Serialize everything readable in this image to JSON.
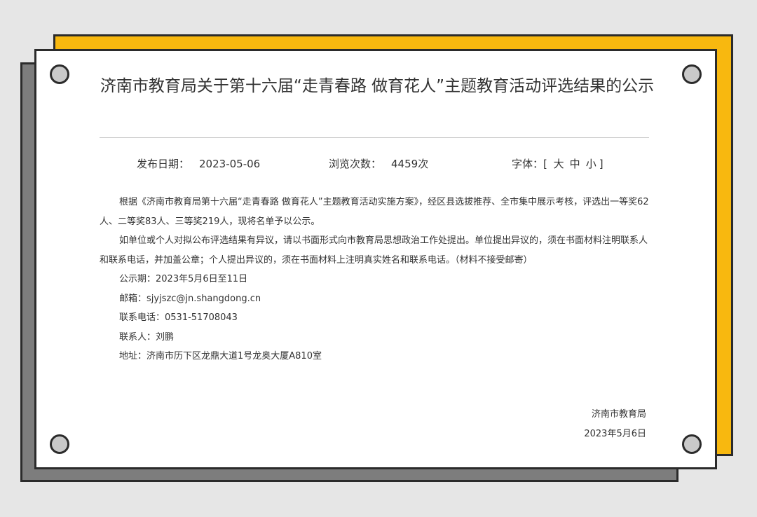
{
  "notice": {
    "title": "济南市教育局关于第十六届“走青春路 做育花人”主题教育活动评选结果的公示",
    "meta": {
      "date_label": "发布日期：",
      "date_value": "2023-05-06",
      "views_label": "浏览次数：",
      "views_value": "4459次",
      "font_label": "字体：",
      "font_open": "[",
      "font_large": "大",
      "font_medium": "中",
      "font_small": "小",
      "font_close": "]"
    },
    "paragraphs": [
      "根据《济南市教育局第十六届“走青春路 做育花人”主题教育活动实施方案》，经区县选拔推荐、全市集中展示考核，评选出一等奖62人、二等奖83人、三等奖219人，现将名单予以公示。",
      "如单位或个人对拟公布评选结果有异议，请以书面形式向市教育局思想政治工作处提出。单位提出异议的，须在书面材料注明联系人和联系电话，并加盖公章；个人提出异议的，须在书面材料上注明真实姓名和联系电话。（材料不接受邮寄）"
    ],
    "lines": [
      "公示期：2023年5月6日至11日",
      "邮箱：sjyjszc@jn.shangdong.cn",
      "联系电话：0531-51708043",
      "联系人：刘鹏",
      "地址：济南市历下区龙鼎大道1号龙奥大厦A810室"
    ],
    "signature_org": "济南市教育局",
    "signature_date": "2023年5月6日"
  }
}
